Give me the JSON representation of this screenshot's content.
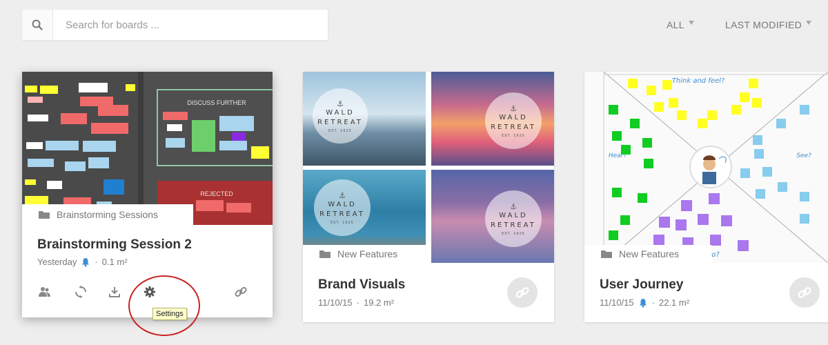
{
  "search": {
    "placeholder": "Search for boards ..."
  },
  "filters": {
    "type_label": "ALL",
    "sort_label": "LAST MODIFIED"
  },
  "boards": [
    {
      "folder": "Brainstorming Sessions",
      "title": "Brainstorming Session 2",
      "modified": "Yesterday",
      "size": "0.1 m²",
      "thumbnail_labels": {
        "discuss": "DISCUSS FURTHER",
        "rejected": "REJECTED"
      },
      "tooltip": "Settings"
    },
    {
      "folder": "New Features",
      "title": "Brand Visuals",
      "modified": "11/10/15",
      "size": "19.2 m²",
      "badge": {
        "line1": "WALD",
        "line2": "RETREAT",
        "line3": "EST. 1925"
      }
    },
    {
      "folder": "New Features",
      "title": "User Journey",
      "modified": "11/10/15",
      "size": "22.1 m²",
      "thumbnail_labels": {
        "think": "Think and feel?",
        "see": "See?",
        "hear": "Hear?",
        "say": "Say and do?"
      }
    }
  ],
  "colors": {
    "accent": "#3b8fd9",
    "highlight": "#cc1f1f",
    "tooltip_bg": "#ffffcc"
  }
}
